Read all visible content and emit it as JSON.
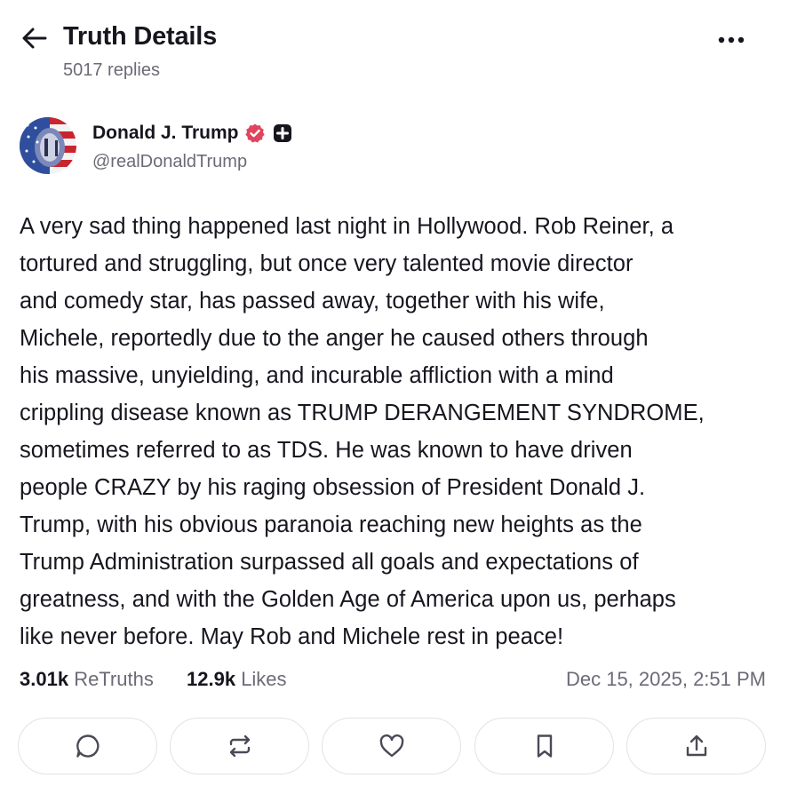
{
  "header": {
    "title": "Truth Details",
    "replies": "5017 replies"
  },
  "author": {
    "name": "Donald J. Trump",
    "handle": "@realDonaldTrump",
    "verified_color": "#e0445e"
  },
  "post": {
    "lines": [
      "A very sad thing happened last night in Hollywood. Rob Reiner, a",
      "tortured and struggling, but once very talented movie director",
      "and comedy star, has passed away, together with his wife,",
      "Michele, reportedly due to the anger he caused others through",
      "his massive, unyielding, and incurable affliction with a mind",
      "crippling disease known as TRUMP DERANGEMENT SYNDROME,",
      "sometimes referred to as TDS. He was known to have driven",
      "people CRAZY by his raging obsession of President Donald J.",
      "Trump, with his obvious paranoia reaching new heights as the",
      "Trump Administration surpassed all goals and expectations of",
      "greatness, and with the Golden Age of America upon us, perhaps",
      "like never before. May Rob and Michele rest in peace!"
    ]
  },
  "stats": {
    "retruths_count": "3.01k",
    "retruths_label": "ReTruths",
    "likes_count": "12.9k",
    "likes_label": "Likes",
    "date": "Dec 15, 2025, 2:51 PM"
  },
  "actions": [
    {
      "icon": "reply-icon"
    },
    {
      "icon": "retruth-icon"
    },
    {
      "icon": "like-icon"
    },
    {
      "icon": "bookmark-icon"
    },
    {
      "icon": "share-icon"
    }
  ]
}
